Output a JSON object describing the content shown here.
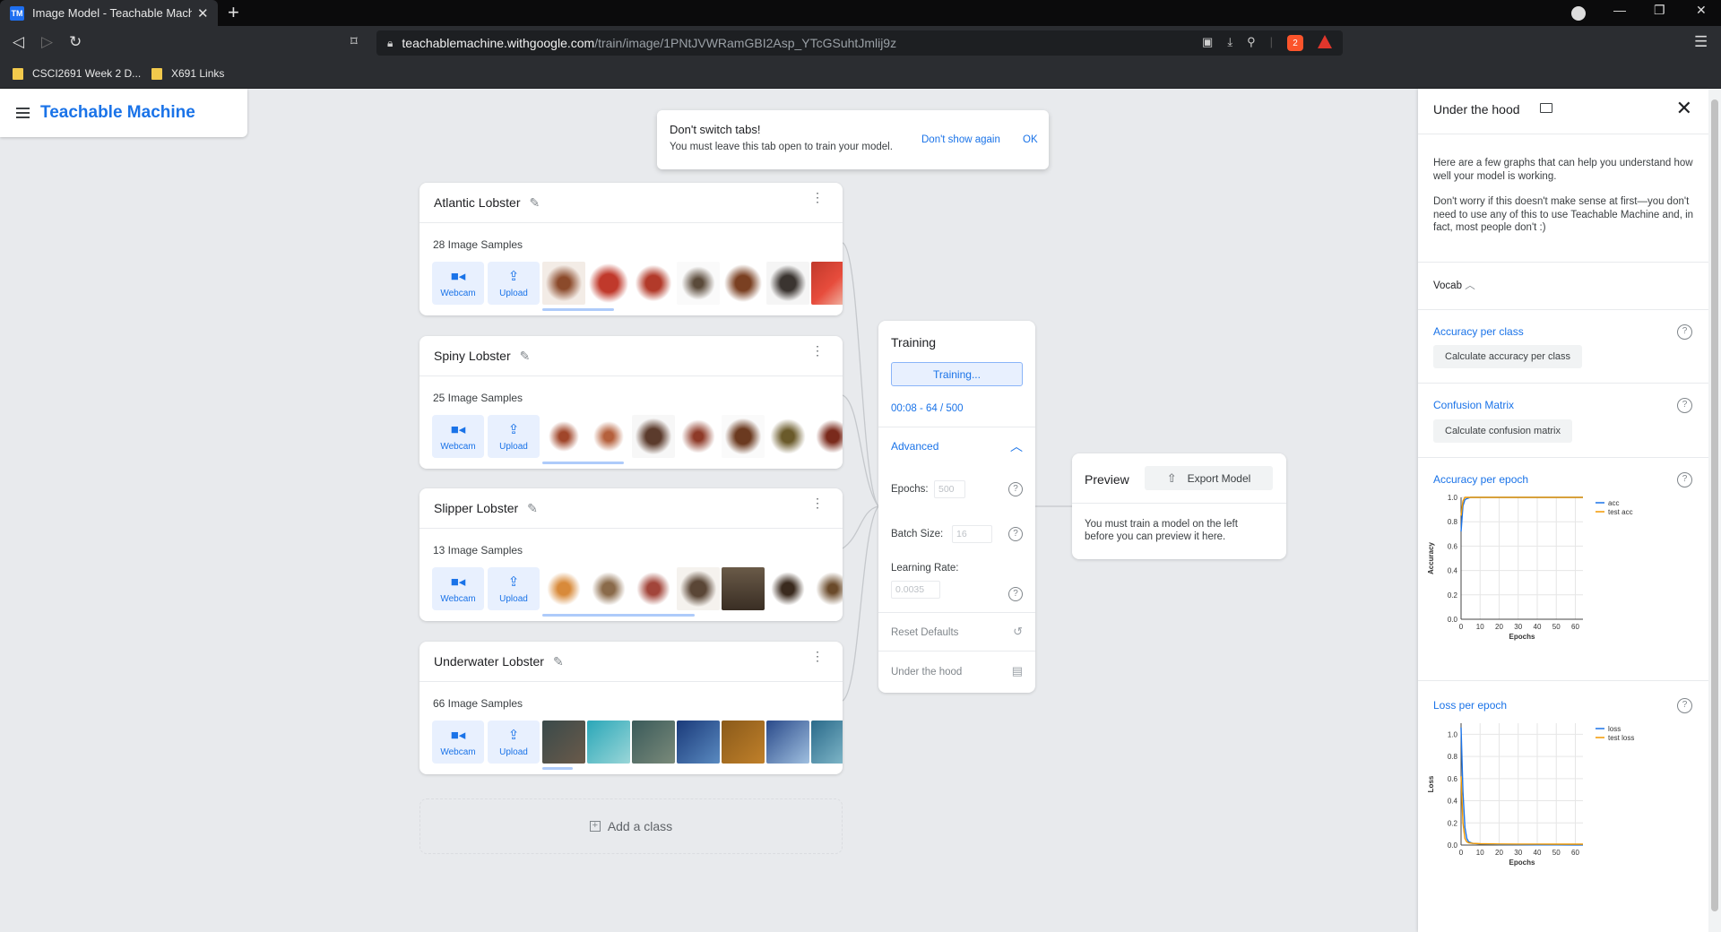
{
  "browser": {
    "tab_title": "Image Model - Teachable Machine",
    "favicon": "TM",
    "url_host": "teachablemachine.withgoogle.com",
    "url_path": "/train/image/1PNtJVWRamGBI2Asp_YTcGSuhtJmlij9z",
    "shield_badge": "2",
    "bookmarks": [
      "CSCI2691 Week 2 D...",
      "X691 Links"
    ]
  },
  "app": {
    "title": "Teachable Machine"
  },
  "toast": {
    "title": "Don't switch tabs!",
    "body": "You must leave this tab open to train your model.",
    "dismiss_label": "Don't show again",
    "ok_label": "OK"
  },
  "classes": [
    {
      "name": "Atlantic Lobster",
      "count": "28 Image Samples",
      "webcam": "Webcam",
      "upload": "Upload"
    },
    {
      "name": "Spiny Lobster",
      "count": "25 Image Samples",
      "webcam": "Webcam",
      "upload": "Upload"
    },
    {
      "name": "Slipper Lobster",
      "count": "13 Image Samples",
      "webcam": "Webcam",
      "upload": "Upload"
    },
    {
      "name": "Underwater Lobster",
      "count": "66 Image Samples",
      "webcam": "Webcam",
      "upload": "Upload"
    }
  ],
  "add_class_label": "Add a class",
  "training": {
    "title": "Training",
    "button_label": "Training...",
    "progress": "00:08 - 64 / 500",
    "advanced_label": "Advanced",
    "epochs_label": "Epochs:",
    "epochs_value": "500",
    "batch_label": "Batch Size:",
    "batch_value": "16",
    "lr_label": "Learning Rate:",
    "lr_value": "0.0035",
    "reset_label": "Reset Defaults",
    "hood_label": "Under the hood"
  },
  "preview": {
    "title": "Preview",
    "export_label": "Export Model",
    "message": "You must train a model on the left before you can preview it here."
  },
  "hood": {
    "title": "Under the hood",
    "intro1": "Here are a few graphs that can help you understand how well your model is working.",
    "intro2": "Don't worry if this doesn't make sense at first—you don't need to use any of this to use Teachable Machine and, in fact, most people don't :)",
    "vocab_label": "Vocab",
    "acc_class_title": "Accuracy per class",
    "acc_class_button": "Calculate accuracy per class",
    "confusion_title": "Confusion Matrix",
    "confusion_button": "Calculate confusion matrix",
    "acc_epoch_title": "Accuracy per epoch",
    "loss_epoch_title": "Loss per epoch"
  },
  "colors": {
    "accent": "#1a73e8",
    "series_a": "#1a73e8",
    "series_b": "#f29900"
  },
  "chart_data": [
    {
      "type": "line",
      "title": "Accuracy per epoch",
      "xlabel": "Epochs",
      "ylabel": "Accuracy",
      "xlim": [
        0,
        64
      ],
      "ylim": [
        0,
        1
      ],
      "xticks": [
        0,
        10,
        20,
        30,
        40,
        50,
        60
      ],
      "yticks": [
        0.0,
        0.2,
        0.4,
        0.6,
        0.8,
        1.0
      ],
      "legend": "top-right",
      "grid": true,
      "series": [
        {
          "name": "acc",
          "x": [
            0,
            1,
            2,
            3,
            5,
            10,
            20,
            30,
            40,
            50,
            60,
            64
          ],
          "y": [
            0.72,
            0.93,
            0.98,
            0.99,
            1.0,
            1.0,
            1.0,
            1.0,
            1.0,
            1.0,
            1.0,
            1.0
          ]
        },
        {
          "name": "test acc",
          "x": [
            0,
            1,
            2,
            3,
            5,
            10,
            20,
            30,
            40,
            50,
            60,
            64
          ],
          "y": [
            0.85,
            0.97,
            1.0,
            1.0,
            1.0,
            1.0,
            1.0,
            1.0,
            1.0,
            1.0,
            1.0,
            1.0
          ]
        }
      ]
    },
    {
      "type": "line",
      "title": "Loss per epoch",
      "xlabel": "Epochs",
      "ylabel": "Loss",
      "xlim": [
        0,
        64
      ],
      "ylim": [
        0,
        1.1
      ],
      "xticks": [
        0,
        10,
        20,
        30,
        40,
        50,
        60
      ],
      "yticks": [
        0.0,
        0.2,
        0.4,
        0.6,
        0.8,
        1.0
      ],
      "legend": "top-right",
      "grid": true,
      "series": [
        {
          "name": "loss",
          "x": [
            0,
            1,
            2,
            3,
            4,
            6,
            10,
            20,
            30,
            40,
            50,
            60,
            64
          ],
          "y": [
            1.06,
            0.48,
            0.16,
            0.06,
            0.03,
            0.015,
            0.01,
            0.005,
            0.003,
            0.002,
            0.002,
            0.001,
            0.001
          ]
        },
        {
          "name": "test loss",
          "x": [
            0,
            1,
            2,
            3,
            4,
            6,
            10,
            20,
            30,
            40,
            50,
            60,
            64
          ],
          "y": [
            0.62,
            0.2,
            0.06,
            0.03,
            0.02,
            0.015,
            0.012,
            0.01,
            0.009,
            0.009,
            0.008,
            0.008,
            0.008
          ]
        }
      ]
    }
  ]
}
